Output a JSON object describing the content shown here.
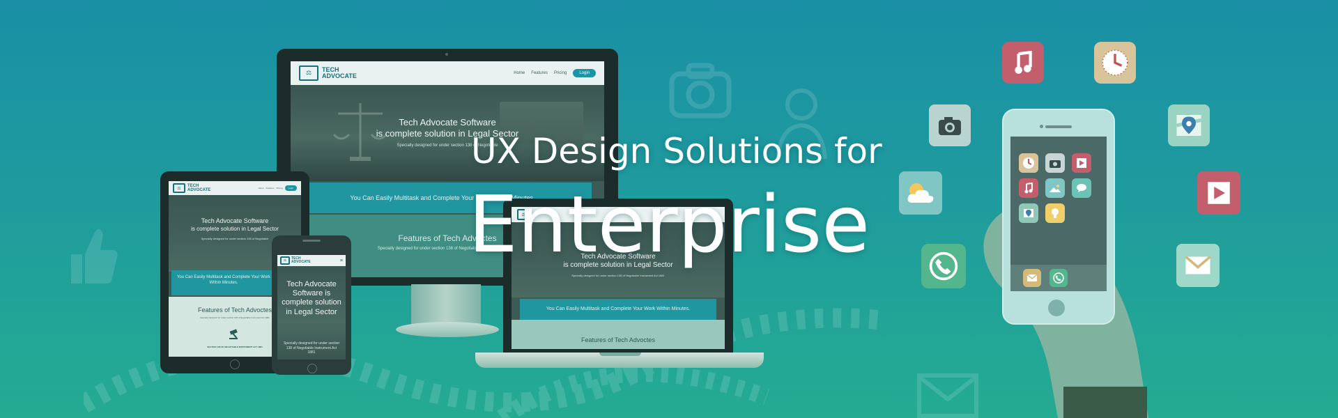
{
  "headline": {
    "line1": "UX Design Solutions for",
    "line2": "Enterprise"
  },
  "site": {
    "logo_line1": "TECH",
    "logo_line2": "ADVOCATE",
    "nav": [
      "Home",
      "Features",
      "Pricing"
    ],
    "login": "Login",
    "hero_line1": "Tech Advocate Software",
    "hero_line2": "is complete solution in Legal Sector",
    "hero_sub": "Specially designed for under section 138 of Negotiable",
    "band": "You Can Easily Multitask and Complete Your Work Within Minutes.",
    "features_title": "Features of Tech Advoctes",
    "features_sub": "Specially designed for under section 138 of Negotiable Instrument Act 1881",
    "section_caption": "SECTION 138 OF NEGOTIABLE INSTRUMENT ACT 1881",
    "phone_hero": "Tech Advocate Software is complete solution in Legal Sector",
    "phone_sub": "Specially designed for under section 138 of Negotiable Instrument Act 1881"
  },
  "colors": {
    "bg_top": "#1a8fa5",
    "bg_bottom": "#24ab92",
    "brand": "#16707a",
    "accent": "#1a95a6"
  },
  "icons": [
    "music-icon",
    "clock-icon",
    "camera-icon",
    "map-icon",
    "weather-icon",
    "video-icon",
    "phone-icon",
    "mail-icon",
    "lightbulb-icon"
  ]
}
